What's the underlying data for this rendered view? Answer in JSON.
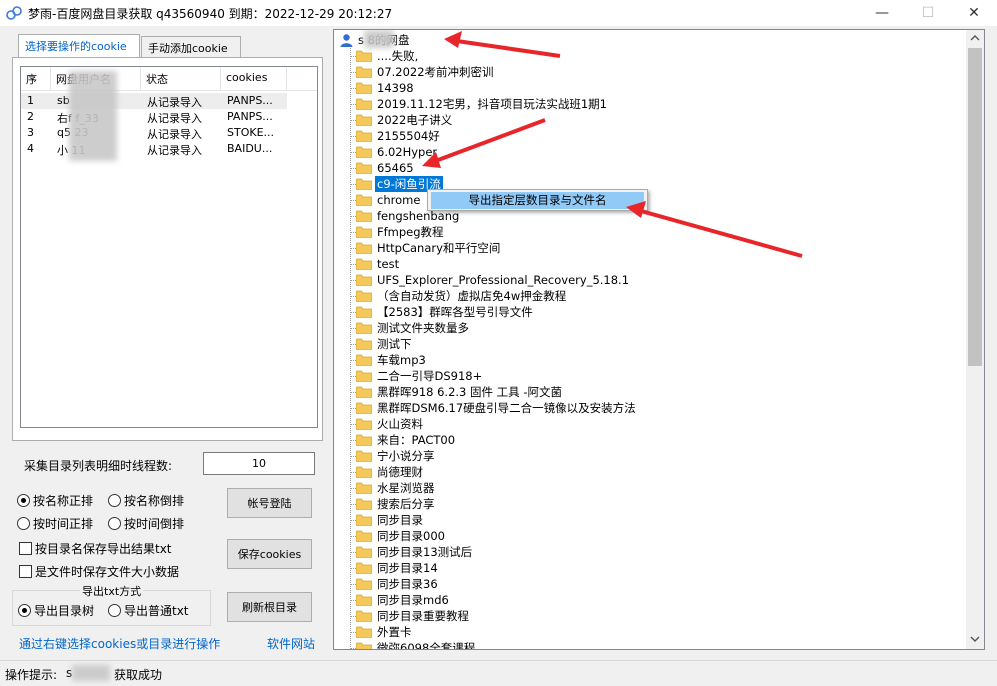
{
  "window": {
    "title": "梦雨-百度网盘目录获取 q43560940  到期：2022-12-29 20:12:27",
    "minimize": "—",
    "maximize": "☐",
    "close": "✕"
  },
  "tabs": [
    {
      "label": "选择要操作的cookie"
    },
    {
      "label": "手动添加cookie"
    }
  ],
  "cookie_table": {
    "columns": [
      "序",
      "网盘用户名",
      "状态",
      "cookies"
    ],
    "rows": [
      {
        "idx": "1",
        "name": "sb",
        "status": "从记录导入",
        "cookie": "PANPS..."
      },
      {
        "idx": "2",
        "name": "右f   f_33",
        "status": "从记录导入",
        "cookie": "PANPS..."
      },
      {
        "idx": "3",
        "name": "q5    23",
        "status": "从记录导入",
        "cookie": "STOKE..."
      },
      {
        "idx": "4",
        "name": "小    11",
        "status": "从记录导入",
        "cookie": "BAIDU..."
      }
    ]
  },
  "threads": {
    "label": "采集目录列表明细时线程数:",
    "value": "10"
  },
  "sort_options": [
    "按名称正排",
    "按名称倒排",
    "按时间正排",
    "按时间倒排"
  ],
  "checks": [
    "按目录名保存导出结果txt",
    "是文件时保存文件大小数据"
  ],
  "export": {
    "group_label": "导出txt方式",
    "options": [
      "导出目录树",
      "导出普通txt"
    ]
  },
  "buttons": {
    "login": "帐号登陆",
    "save_cookies": "保存cookies",
    "refresh": "刷新根目录"
  },
  "hint_link": "通过右键选择cookies或目录进行操作",
  "site_link": "软件网站",
  "status": {
    "label": "操作提示:",
    "text_prefix": "s",
    "text_suffix": "获取成功"
  },
  "tree": {
    "root": "s      8的网盘",
    "items": [
      "....失败,",
      "07.2022考前冲刺密训",
      "14398",
      "2019.11.12宅男，抖音项目玩法实战班1期1",
      "2022电子讲义",
      "2155504好",
      "6.02Hyper",
      "65465",
      "c9-闲鱼引流",
      "chrome",
      "fengshenbang",
      "Ffmpeg教程",
      "HttpCanary和平行空间",
      "test",
      "UFS_Explorer_Professional_Recovery_5.18.1",
      "（含自动发货）虚拟店免4w押金教程",
      "【2583】群晖各型号引导文件",
      "测试文件夹数量多",
      "测试下",
      "车载mp3",
      "二合一引导DS918+",
      "黑群晖918 6.2.3 固件 工具 -阿文菌",
      "黑群晖DSM6.17硬盘引导二合一镜像以及安装方法",
      "火山资料",
      "来自：PACT00",
      "宁小说分享",
      "尚德理财",
      "水星浏览器",
      "搜索后分享",
      "同步目录",
      "同步目录000",
      "同步目录13测试后",
      "同步目录14",
      "同步目录36",
      "同步目录md6",
      "同步目录重要教程",
      "外置卡",
      "微弥6098全套课程"
    ],
    "selected_index": 8
  },
  "context_menu": {
    "item": "导出指定层数目录与文件名"
  },
  "colors": {
    "selection": "#0078d7",
    "menu_highlight": "#91c9f7",
    "arrow": "#e8262a",
    "folder": "#f5c85a"
  }
}
